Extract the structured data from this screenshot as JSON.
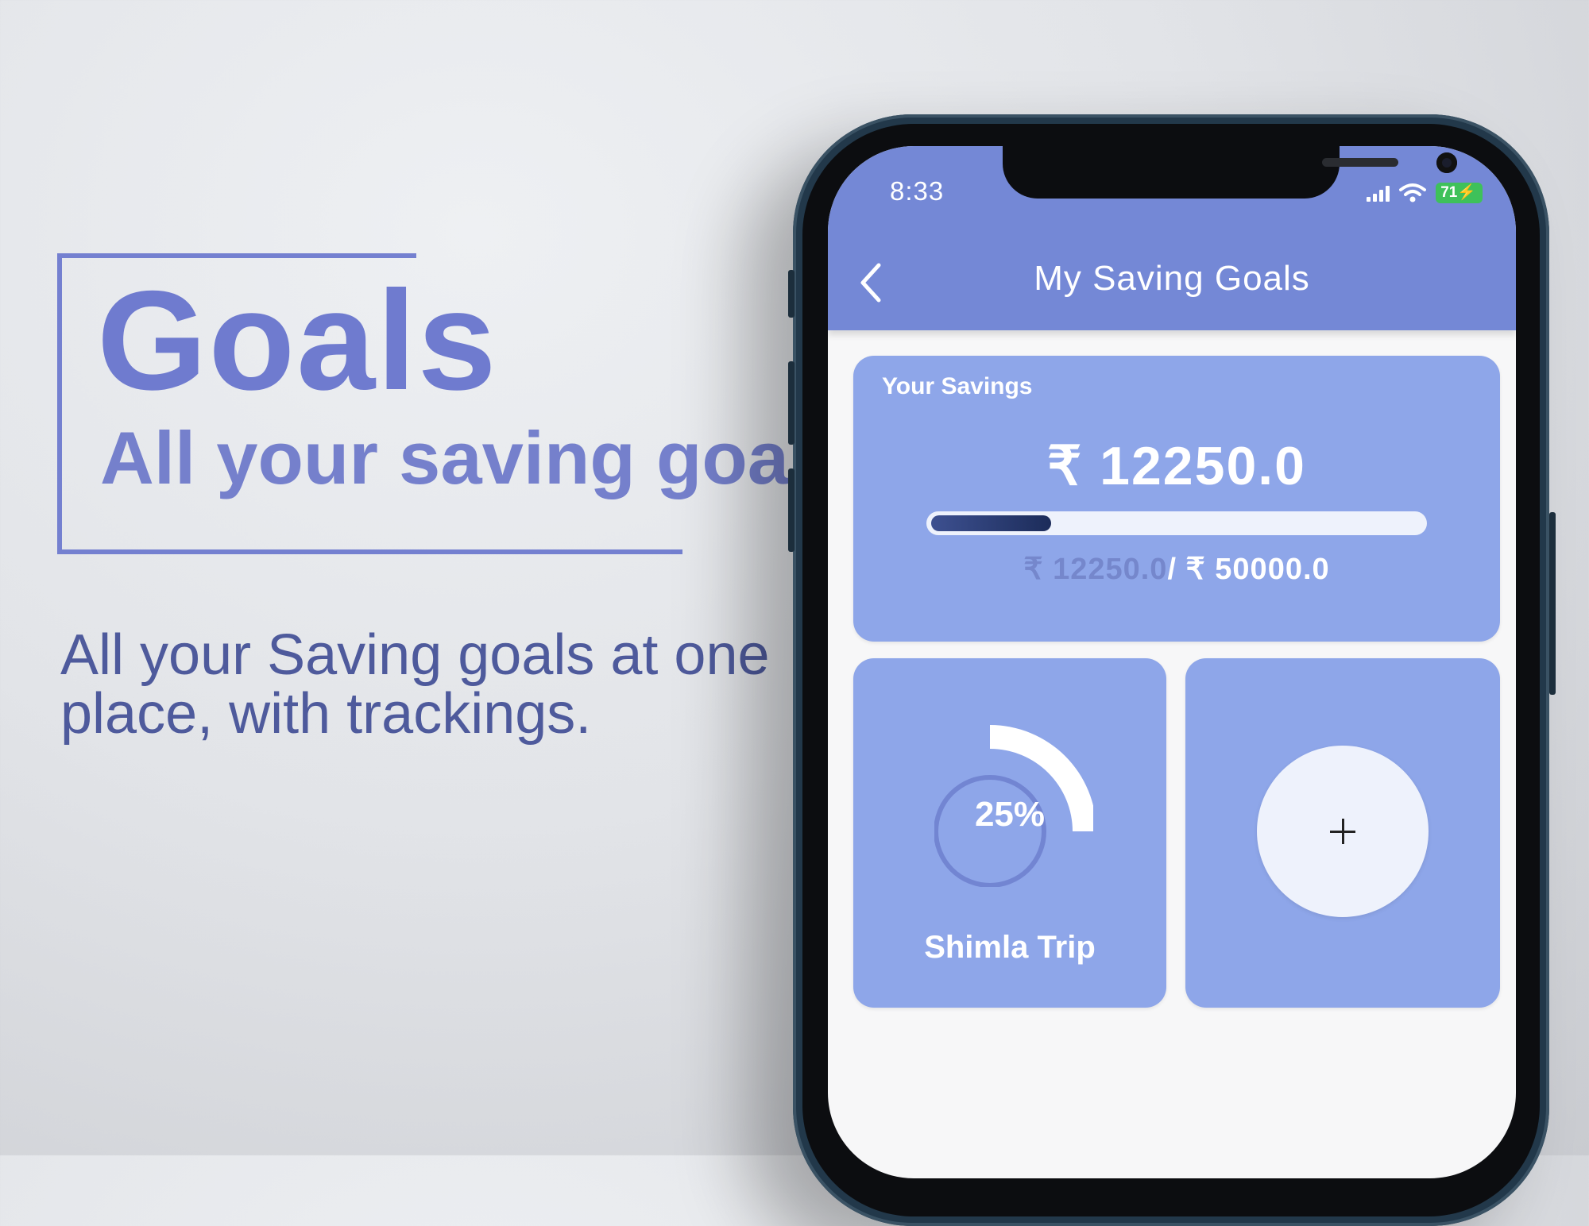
{
  "hero": {
    "title": "Goals",
    "subtitle": "All your saving goals",
    "description": "All your Saving goals at one place, with trackings."
  },
  "status_bar": {
    "time": "8:33",
    "battery": "71",
    "icons": [
      "cellular-signal-icon",
      "wifi-icon",
      "battery-charging-icon"
    ]
  },
  "app_bar": {
    "title": "My Saving Goals",
    "back_icon": "chevron-left-icon"
  },
  "savings": {
    "label": "Your Savings",
    "amount": "₹ 12250.0",
    "current": "₹ 12250.0",
    "separator": "/",
    "total": " ₹ 50000.0",
    "progress_fraction": 0.245
  },
  "goals": [
    {
      "name": "Shimla Trip",
      "percent_label": "25%",
      "progress_fraction": 0.25
    }
  ],
  "add_goal": {
    "icon": "plus-icon"
  },
  "colors": {
    "accent": "#7488d6",
    "card": "#8ea6e9",
    "hero_text": "#6f7bcf",
    "progress_fill": "#1c2c5a",
    "battery": "#3ec15a"
  }
}
